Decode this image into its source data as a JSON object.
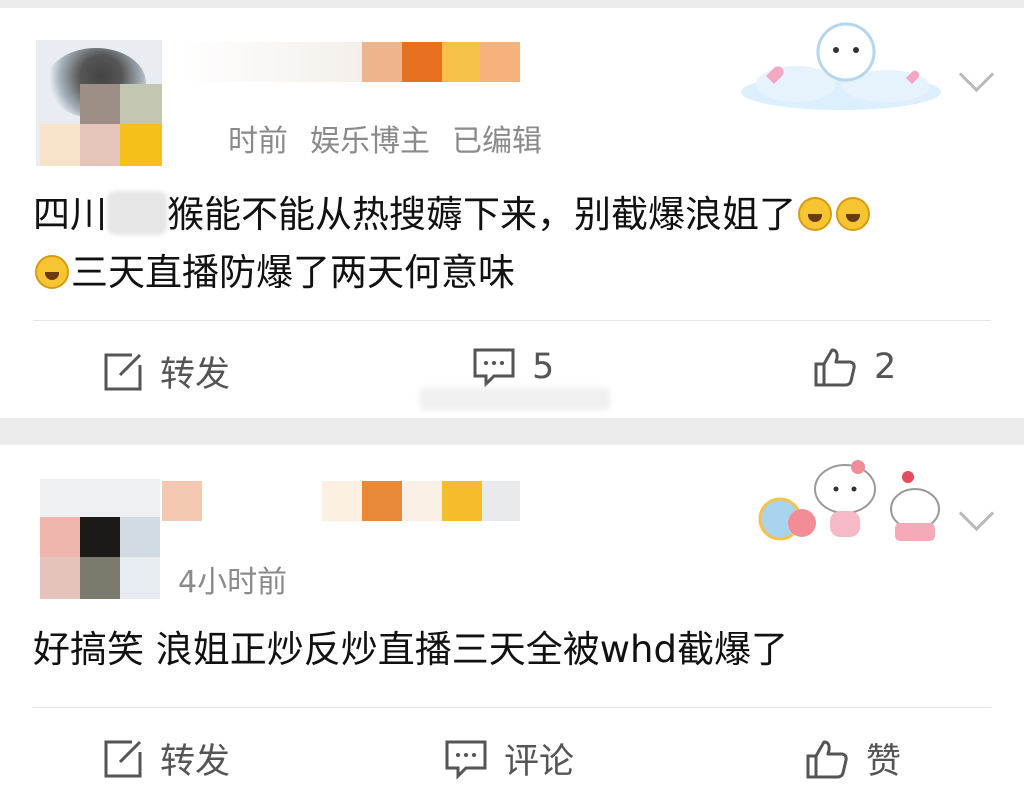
{
  "comments": [
    {
      "time_prefix": "",
      "time": "时前",
      "role": "娱乐博主",
      "edited": "已编辑",
      "text_part1": "四川",
      "text_part2": "猴能不能从热搜薅下来，别截爆浪姐了",
      "text_part3": "三天直播防爆了两天何意味",
      "actions": {
        "repost": "转发",
        "comment": "5",
        "like": "2"
      },
      "emoji": "laugh-cry-emoji"
    },
    {
      "time": "4小时前",
      "text": "好搞笑 浪姐正炒反炒直播三天全被whd截爆了",
      "actions": {
        "repost": "转发",
        "comment": "评论",
        "like": "赞"
      }
    }
  ],
  "colors": {
    "text": "#111111",
    "meta": "#8a8a8a",
    "action": "#555555",
    "background": "#ececec"
  },
  "icons": [
    "repost-icon",
    "comment-icon",
    "thumbs-up-icon",
    "chevron-down-icon",
    "laugh-cry-emoji"
  ]
}
